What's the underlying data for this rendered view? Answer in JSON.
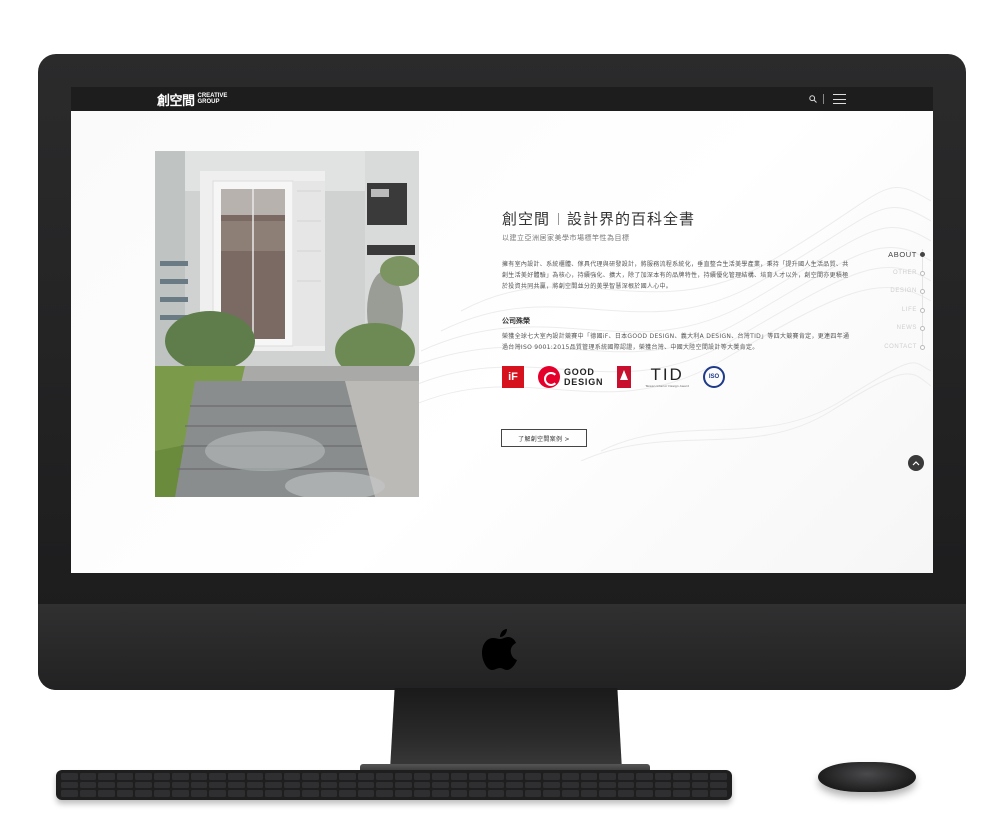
{
  "header": {
    "logo_cn": "創空間",
    "logo_en_line1": "CREATIVE",
    "logo_en_line2": "GROUP"
  },
  "about": {
    "headline_left": "創空間",
    "headline_right": "設計界的百科全書",
    "subtitle": "以建立亞洲居家美學市場標竿性為目標",
    "paragraph": "擁有室內設計、系統櫃體、傢具代理與研發設計，將服務流程系統化，垂直整合生活美學產業，秉持「提升國人生活品質、共創生活美好體驗」為核心，持續強化、擴大，除了加深本有的品牌特性，持續優化管理結構、培育人才以外，創空間亦更積極於投資共同共贏，將創空間並分的美學智慧深根於國人心中。",
    "awards_title": "公司殊榮",
    "awards_paragraph": "榮獲全球七大室內設計競賽中「德國iF、日本GOOD DESIGN、義大利A DESIGN、台灣TID」等四大競賽肯定，更連四年通過台灣ISO 9001:2015品質管理系統國際認證，榮獲台灣、中國大陸空間設計等大獎肯定。",
    "cta_label": "了解創空間案例 >"
  },
  "award_logos": {
    "if": "iF",
    "good_line1": "GOOD",
    "good_line2": "DESIGN",
    "tid": "TID",
    "tid_sub": "Taiwan Interior Design Award",
    "iso": "ISO"
  },
  "side_nav": {
    "items": [
      "ABOUT",
      "OTHER",
      "DESIGN",
      "LIFE",
      "NEWS",
      "CONTACT"
    ],
    "active_index": 0
  },
  "colors": {
    "topbar": "#1d1d1d",
    "if_red": "#d7121f",
    "good_red": "#e4002b",
    "iso_blue": "#1e3a8a"
  }
}
